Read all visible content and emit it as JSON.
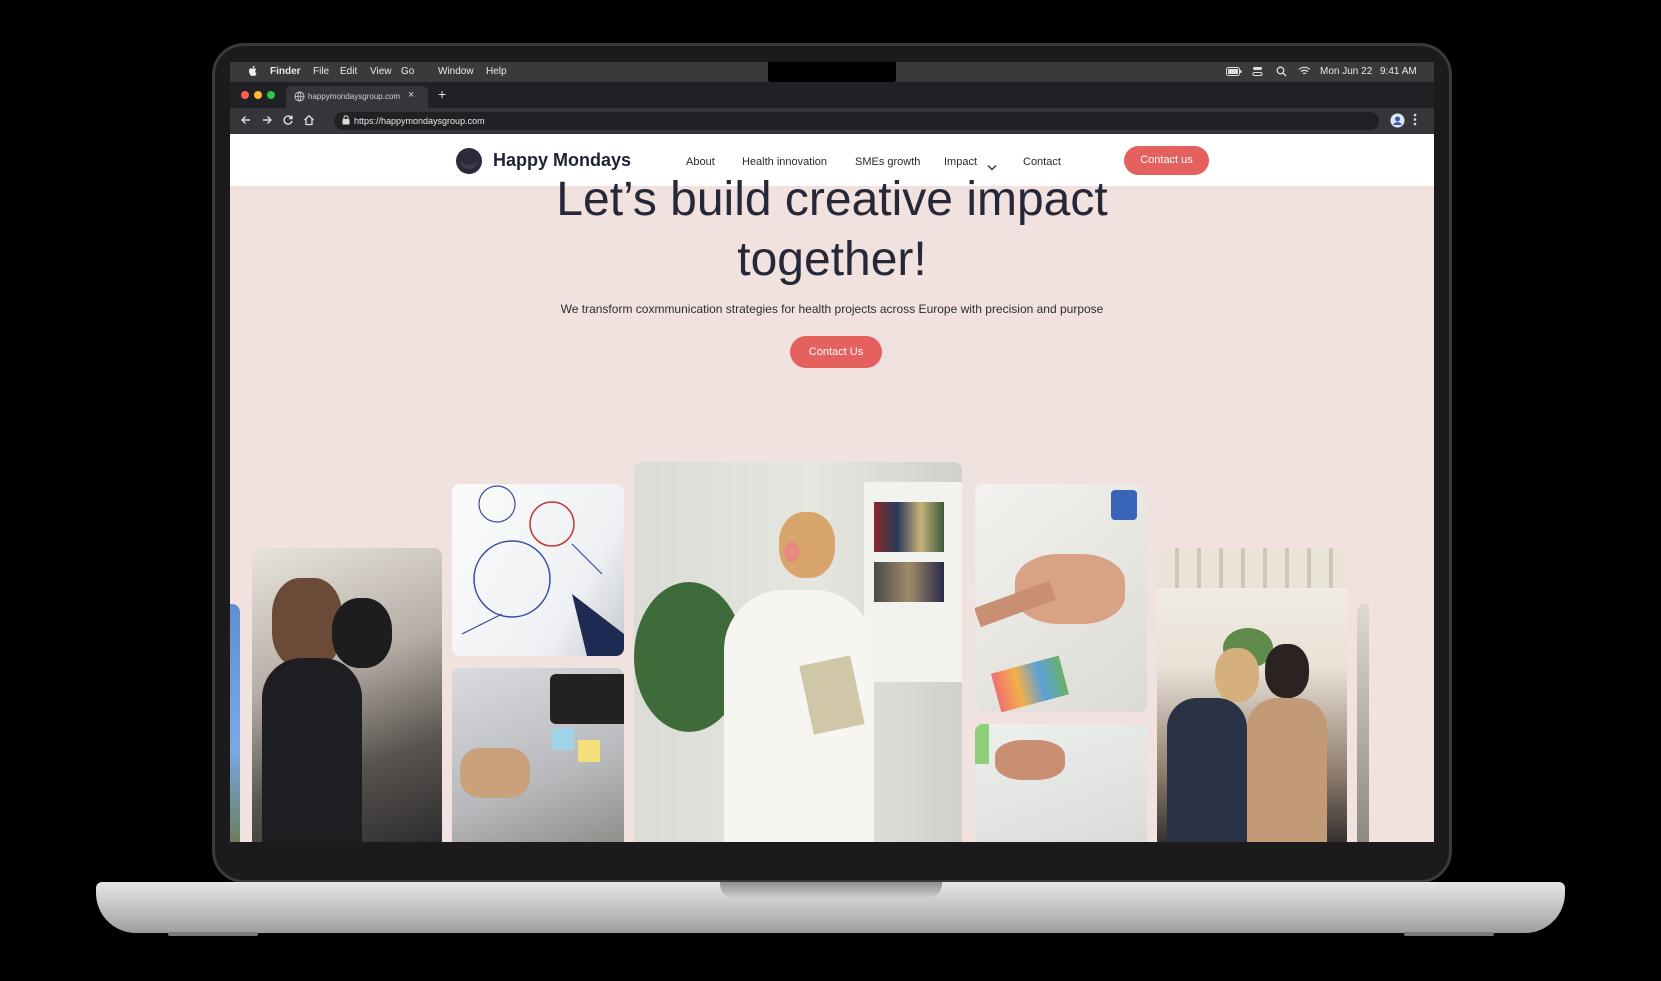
{
  "os_menubar": {
    "app_name": "Finder",
    "menus": [
      "File",
      "Edit",
      "View",
      "Go",
      "Window",
      "Help"
    ],
    "date": "Mon Jun 22",
    "time": "9:41 AM"
  },
  "browser": {
    "tab_title": "happymondaysgroup.com",
    "new_tab_symbol": "+",
    "url": "https://happymondaysgroup.com"
  },
  "site": {
    "brand_name": "Happy Mondays",
    "nav_items": [
      "About",
      "Health innovation",
      "SMEs growth",
      "Impact",
      "Contact"
    ],
    "nav_cta": "Contact us",
    "hero_title_line1": "Let’s build creative impact",
    "hero_title_line2": "together!",
    "hero_subtitle": "We transform coxmmunication strategies for health projects across Europe with precision and purpose",
    "hero_cta": "Contact Us"
  },
  "colors": {
    "accent": "#e4615f",
    "hero_background": "#f1e2e0",
    "heading": "#262838"
  },
  "icons": [
    "apple-icon",
    "globe-icon",
    "close-icon",
    "back-icon",
    "forward-icon",
    "reload-icon",
    "home-icon",
    "lock-icon",
    "profile-icon",
    "more-icon",
    "battery-icon",
    "control-center-icon",
    "search-icon",
    "wifi-icon",
    "chevron-down-icon"
  ]
}
